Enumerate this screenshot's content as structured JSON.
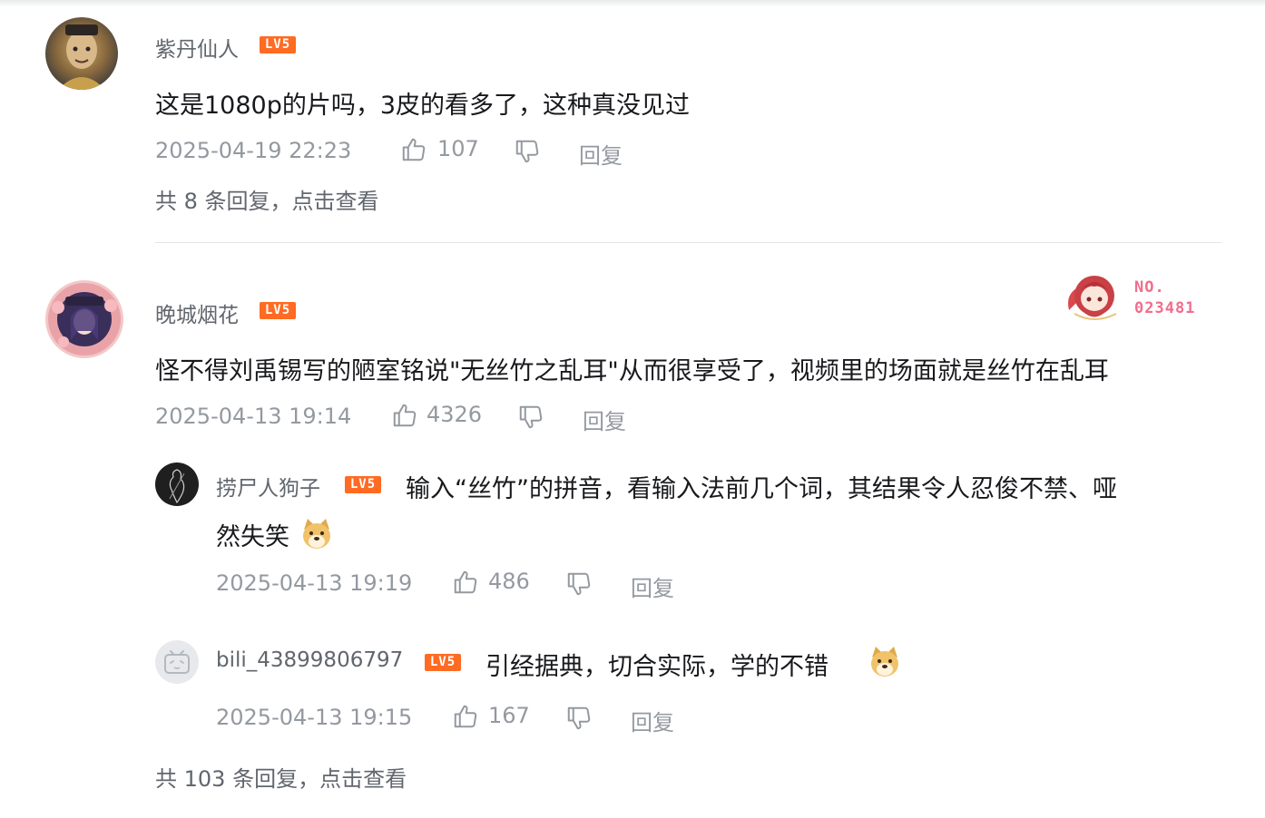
{
  "comments": [
    {
      "username": "紫丹仙人",
      "level": "LV5",
      "content": "这是1080p的片吗，3皮的看多了，这种真没见过",
      "time": "2025-04-19 22:23",
      "likes": "107",
      "reply_label": "回复",
      "more_replies": "共 8 条回复，点击查看",
      "replies": []
    },
    {
      "username": "晚城烟花",
      "level": "LV5",
      "fan_badge": {
        "label": "NO.",
        "number": "023481"
      },
      "content": "怪不得刘禹锡写的陋室铭说\"无丝竹之乱耳\"从而很享受了，视频里的场面就是丝竹在乱耳",
      "time": "2025-04-13 19:14",
      "likes": "4326",
      "reply_label": "回复",
      "more_replies": "共 103 条回复，点击查看",
      "replies": [
        {
          "username": "捞尸人狗子",
          "level": "LV5",
          "content_line1": "输入“丝竹”的拼音，看输入法前几个词，其结果令人忍俊不禁、哑",
          "content_line2": "然失笑",
          "emoji": "doge-emoji",
          "time": "2025-04-13 19:19",
          "likes": "486",
          "reply_label": "回复"
        },
        {
          "username": "bili_43899806797",
          "level": "LV5",
          "content": "引经据典，切合实际，学的不错",
          "emoji": "doge-emoji",
          "time": "2025-04-13 19:15",
          "likes": "167",
          "reply_label": "回复"
        }
      ]
    }
  ],
  "colors": {
    "level_badge": "#ff6b22",
    "meta_text": "#9499a0",
    "fan_badge": "#f26d8c"
  },
  "icons": [
    "thumbs-up-icon",
    "thumbs-down-icon",
    "doge-emoji"
  ]
}
